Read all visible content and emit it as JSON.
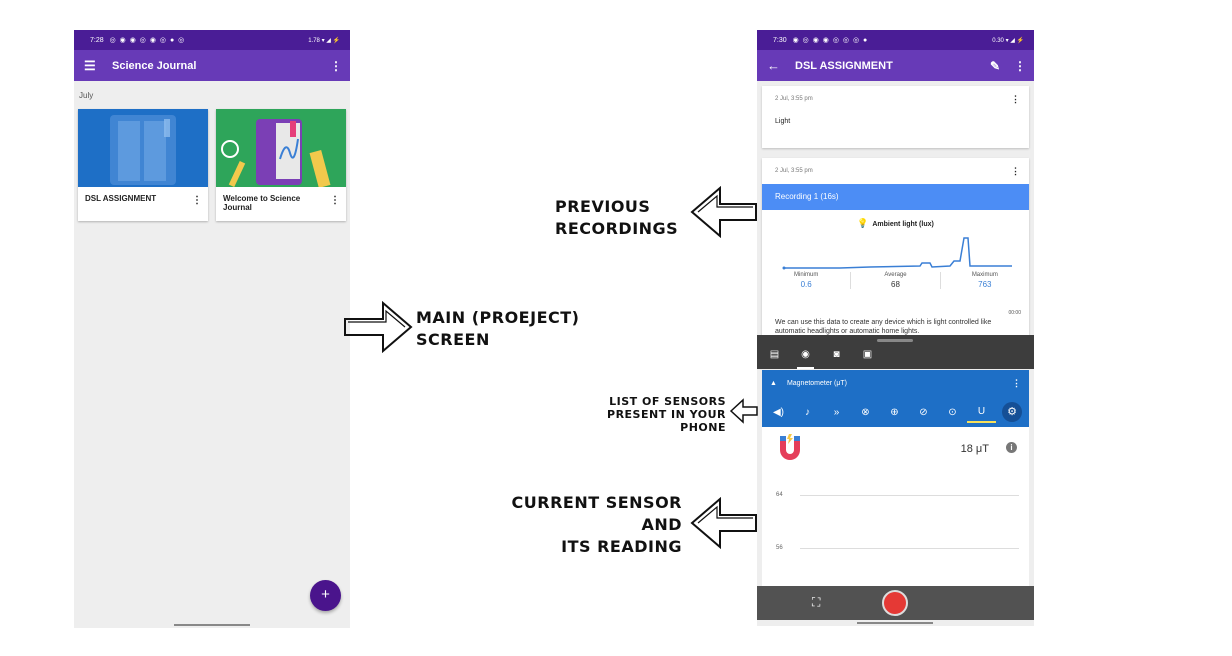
{
  "left_phone": {
    "status": {
      "time": "7:28",
      "icons": "◎ ◉ ◉ ◎ ◉ ◎ ● ◎",
      "right": "1.78 ▾ ◢ ⚡"
    },
    "appbar": {
      "title": "Science Journal"
    },
    "section_label": "July",
    "cards": [
      {
        "title": "DSL ASSIGNMENT"
      },
      {
        "title": "Welcome to Science Journal"
      }
    ],
    "fab_label": "+"
  },
  "right_phone": {
    "status": {
      "time": "7:30",
      "icons": "◉ ◎ ◉ ◉ ◎ ◎ ◎ ●",
      "right": "0.30 ▾ ◢ ⚡"
    },
    "appbar": {
      "title": "DSL ASSIGNMENT"
    },
    "entries": [
      {
        "timestamp": "2 Jul, 3:55 pm",
        "note": "Light"
      },
      {
        "timestamp": "2 Jul, 3:55 pm"
      }
    ],
    "recording": {
      "header": "Recording 1 (16s)",
      "sensor": "Ambient light (lux)",
      "stats": [
        {
          "label": "Minimum",
          "value": "0.6"
        },
        {
          "label": "Average",
          "value": "68"
        },
        {
          "label": "Maximum",
          "value": "763"
        }
      ],
      "timecode": "00:00",
      "description": "We can use this data to create any device which is light controlled like automatic headlights or automatic home lights."
    },
    "sensor_panel": {
      "title": "Magnetometer (μT)",
      "reading": "18 μT",
      "grid_labels": [
        "64",
        "56"
      ]
    }
  },
  "annotations": {
    "previous_recordings": [
      "PREVIOUS",
      "RECORDINGS"
    ],
    "main_screen": [
      "MAIN (PROEJECT)",
      "SCREEN"
    ],
    "list_of_sensors": [
      "LIST OF SENSORS",
      "PRESENT IN YOUR PHONE"
    ],
    "current_sensor": [
      "CURRENT SENSOR",
      "AND",
      "ITS READING"
    ]
  },
  "colors": {
    "appbar": "#673ab7",
    "statusbar": "#4a1d96",
    "fab": "#4a148c",
    "recording_header": "#4c8df5",
    "sensor_panel": "#1e6fc6",
    "record_button": "#e53935",
    "max_value": "#3a7fd5"
  },
  "icons": {
    "left_appbar": [
      "menu-icon",
      "more-vert-icon"
    ],
    "right_appbar": [
      "back-arrow-icon",
      "edit-icon",
      "more-vert-icon"
    ],
    "tools": [
      "note-icon",
      "sensor-icon",
      "camera-icon",
      "gallery-icon"
    ],
    "sensor_tabs": [
      "sound-icon",
      "music-note-icon",
      "fast-forward-icon",
      "accelerometer-x-icon",
      "accelerometer-y-icon",
      "accelerometer-z-icon",
      "compass-icon",
      "magnet-icon",
      "settings-icon"
    ]
  }
}
